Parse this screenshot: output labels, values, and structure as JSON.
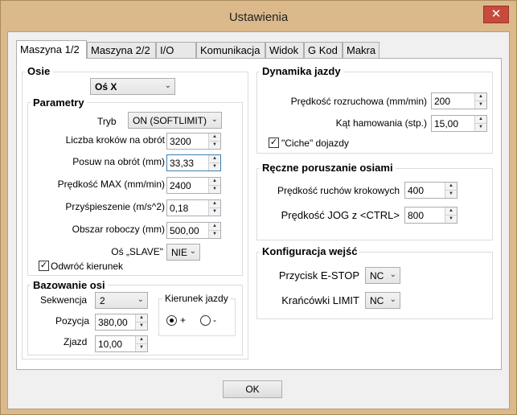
{
  "window": {
    "title": "Ustawienia",
    "close": "✕"
  },
  "tabs": [
    "Maszyna 1/2",
    "Maszyna 2/2",
    "I/O",
    "Komunikacja",
    "Widok",
    "G Kod",
    "Makra"
  ],
  "osie": {
    "title": "Osie",
    "axis_select": "Oś X",
    "parametry": {
      "title": "Parametry",
      "tryb_label": "Tryb",
      "tryb_value": "ON (SOFTLIMIT)",
      "fields": [
        {
          "label": "Liczba kroków na obrót",
          "value": "3200"
        },
        {
          "label": "Posuw na obrót (mm)",
          "value": "33,33"
        },
        {
          "label": "Prędkość MAX (mm/min)",
          "value": "2400"
        },
        {
          "label": "Przyśpieszenie (m/s^2)",
          "value": "0,18"
        },
        {
          "label": "Obszar roboczy (mm)",
          "value": "500,00"
        }
      ],
      "slave_label": "Oś „SLAVE\"",
      "slave_value": "NIE",
      "odwroc_label": "Odwróć kierunek",
      "odwroc_checked": true
    },
    "bazowanie": {
      "title": "Bazowanie osi",
      "sekwencja_label": "Sekwencja",
      "sekwencja_value": "2",
      "pozycja_label": "Pozycja",
      "pozycja_value": "380,00",
      "zjazd_label": "Zjazd",
      "zjazd_value": "10,00",
      "kierunek_label": "Kierunek jazdy",
      "plus_label": "+",
      "minus_label": "-",
      "selected": "+"
    }
  },
  "dynamika": {
    "title": "Dynamika jazdy",
    "rozruch_label": "Prędkość rozruchowa (mm/min)",
    "rozruch_value": "200",
    "kat_label": "Kąt hamowania (stp.)",
    "kat_value": "15,00",
    "ciche_label": "\"Ciche\" dojazdy",
    "ciche_checked": true
  },
  "reczne": {
    "title": "Ręczne poruszanie osiami",
    "krok_label": "Prędkość ruchów krokowych",
    "krok_value": "400",
    "jog_label": "Prędkość  JOG z <CTRL>",
    "jog_value": "800"
  },
  "konfig": {
    "title": "Konfiguracja wejść",
    "estop_label": "Przycisk E-STOP",
    "estop_value": "NC",
    "limit_label": "Krańcówki LIMIT",
    "limit_value": "NC"
  },
  "ok_label": "OK",
  "icons": {
    "spin_up": "▲",
    "spin_down": "▼",
    "combo_arrow": "⌄",
    "check": "✓"
  }
}
